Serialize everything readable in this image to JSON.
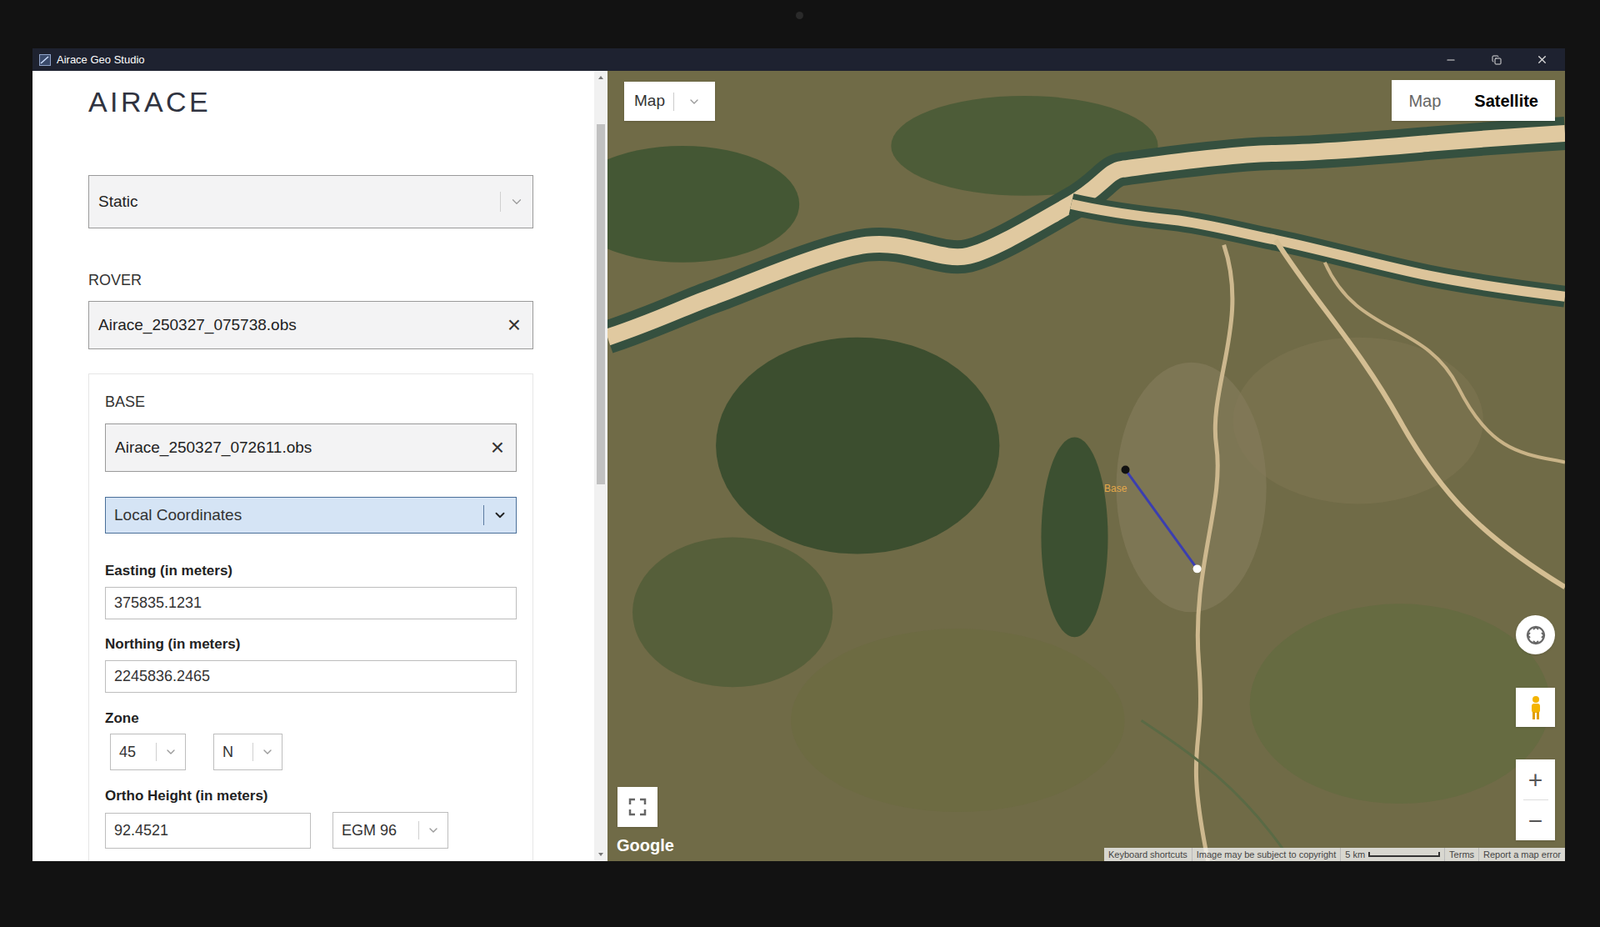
{
  "window": {
    "title": "Airace Geo Studio"
  },
  "logo": "AIRACE",
  "mode_select": {
    "value": "Static"
  },
  "rover": {
    "label": "ROVER",
    "file": "Airace_250327_075738.obs",
    "clear": "×"
  },
  "base": {
    "label": "BASE",
    "file": "Airace_250327_072611.obs",
    "clear": "×",
    "coordinate_type": "Local Coordinates",
    "fields": [
      {
        "label": "Easting (in meters)",
        "value": "375835.1231"
      },
      {
        "label": "Northing (in meters)",
        "value": "2245836.2465"
      }
    ],
    "zone": {
      "label": "Zone",
      "number": "45",
      "hemisphere": "N"
    },
    "ortho_height": {
      "label": "Ortho Height (in meters)",
      "value": "92.4521",
      "geoid": "EGM 96"
    }
  },
  "map": {
    "type_select": "Map",
    "view_toggle": [
      {
        "label": "Map",
        "selected": false
      },
      {
        "label": "Satellite",
        "selected": true
      }
    ],
    "base_marker": {
      "label": "Base"
    },
    "zoom": {
      "in": "+",
      "out": "−"
    },
    "logo": "Google",
    "attribution": [
      "Keyboard shortcuts",
      "Image may be subject to copyright"
    ],
    "scale": "5 km",
    "links": [
      "Terms",
      "Report a map error"
    ]
  }
}
